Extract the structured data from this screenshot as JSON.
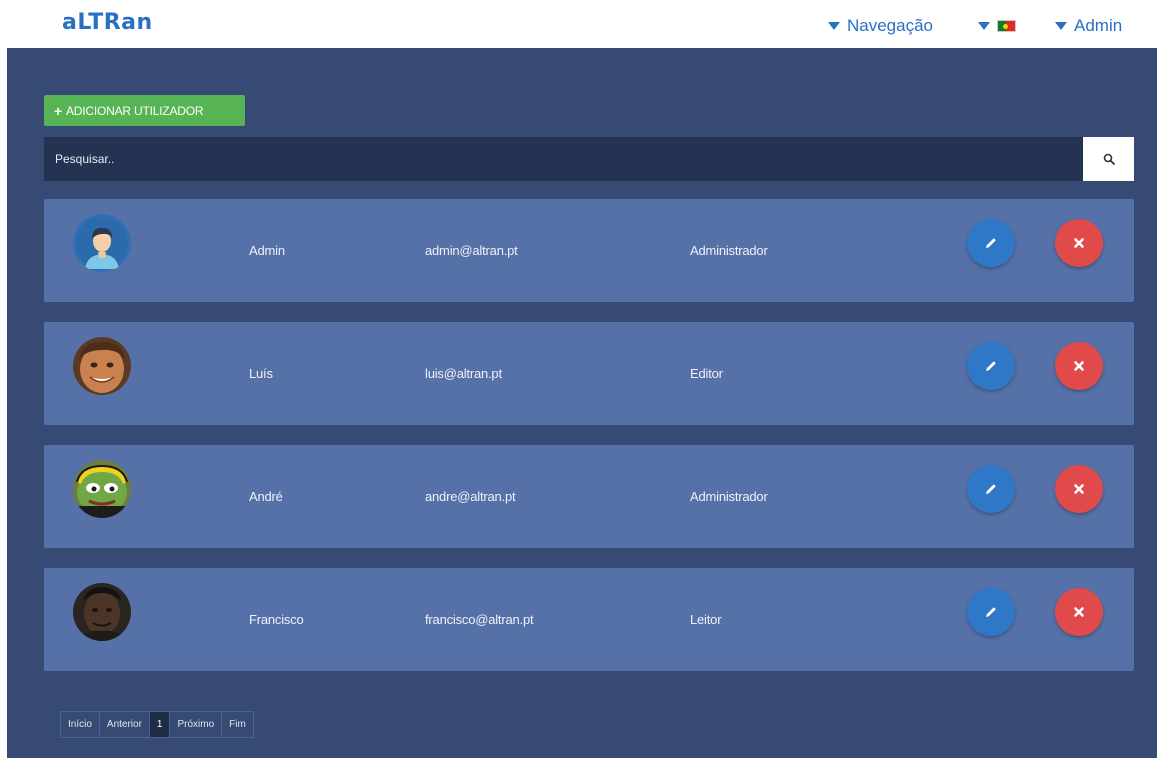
{
  "header": {
    "logo": "aLTRan",
    "nav_label": "Navegação",
    "language": "Português",
    "user_label": "Admin"
  },
  "toolbar": {
    "add_user_label": "ADICIONAR UTILIZADOR"
  },
  "search": {
    "placeholder": "Pesquisar.."
  },
  "users": [
    {
      "name": "Admin",
      "email": "admin@altran.pt",
      "role": "Administrador",
      "avatar": "default-user-avatar"
    },
    {
      "name": "Luís",
      "email": "luis@altran.pt",
      "role": "Editor",
      "avatar": "user-photo"
    },
    {
      "name": "André",
      "email": "andre@altran.pt",
      "role": "Administrador",
      "avatar": "frog-avatar"
    },
    {
      "name": "Francisco",
      "email": "francisco@altran.pt",
      "role": "Leitor",
      "avatar": "user-photo"
    }
  ],
  "pagination": {
    "first": "Início",
    "prev": "Anterior",
    "current": "1",
    "next": "Próximo",
    "last": "Fim"
  },
  "colors": {
    "brand": "#2a6fc4",
    "panel": "#364a73",
    "row": "#5670a8",
    "add": "#56b454",
    "edit": "#2e78c7",
    "delete": "#e04a4a"
  }
}
